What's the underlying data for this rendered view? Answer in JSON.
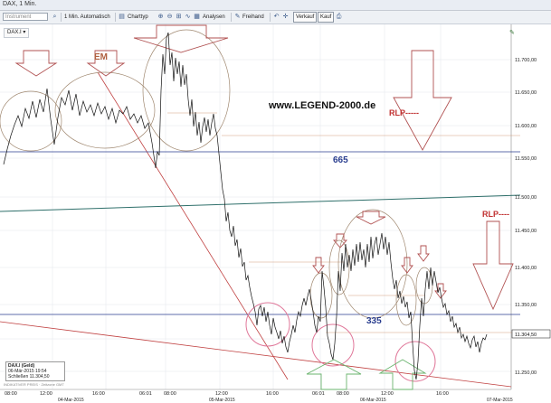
{
  "window": {
    "title": "DAX, 1 Min."
  },
  "toolbar": {
    "instrument_placeholder": "Instrument",
    "interval": "1 Min. Automatisch",
    "charttyp": "Charttyp",
    "analysen": "Analysen",
    "freihand": "Freihand",
    "verkauf": "Verkauf",
    "kauf": "Kauf"
  },
  "symbol": "DAX.I",
  "annotations": {
    "em": "EM",
    "watermark": "www.LEGEND-2000.de",
    "rlp1": "RLP-----",
    "rlp2": "RLP----",
    "n665": "665",
    "n335": "335"
  },
  "y_axis": {
    "ticks": [
      "11.700,00",
      "11.650,00",
      "11.600,00",
      "11.550,00",
      "11.500,00",
      "11.450,00",
      "11.400,00",
      "11.350,00",
      "11.300,00",
      "11.250,00"
    ],
    "current": "11.304,50"
  },
  "x_axis": {
    "time_ticks": [
      "08:00",
      "12:00",
      "16:00",
      "06:01",
      "08:00",
      "12:00",
      "16:00",
      "06:01",
      "08:00",
      "12:00",
      "16:00"
    ],
    "date_ticks": [
      "04-Mar-2015",
      "05-Mar-2015",
      "06-Mar-2015",
      "07-Mar-2015"
    ]
  },
  "info": {
    "title": "DAX.I (Geld)",
    "date": "06-Mär-2015 19:54",
    "close_label": "Schließen",
    "close_value": "11.304,50"
  },
  "footer": "INDIKATIVER PREIS · Zeitzone GMT",
  "colors": {
    "price": "#111111",
    "annotation": "#b03030",
    "blue": "#2a3e8f",
    "teal": "#2e6f6a",
    "pink": "#e0789a",
    "green": "#4caf50"
  }
}
